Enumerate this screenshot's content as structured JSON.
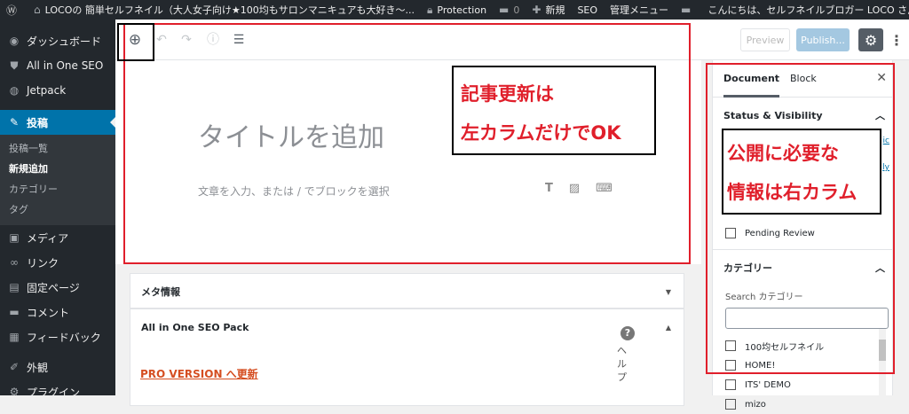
{
  "adminbar": {
    "site_name": "LOCOの 簡単セルフネイル（大人女子向け★100均もサロンマニキュアも大好き〜...",
    "protection": "Protection",
    "comments_count": "0",
    "new_label": "新規",
    "seo_label": "SEO",
    "admin_menu": "管理メニュー",
    "greeting": "こんにちは、セルフネイルブロガー LOCO さん"
  },
  "sidebar": {
    "items": [
      {
        "label": "ダッシュボード",
        "icon": "dashboard-icon"
      },
      {
        "label": "All in One SEO",
        "icon": "shield-icon"
      },
      {
        "label": "Jetpack",
        "icon": "jetpack-icon"
      },
      {
        "label": "投稿",
        "icon": "pin-icon"
      },
      {
        "label": "メディア",
        "icon": "media-icon"
      },
      {
        "label": "リンク",
        "icon": "link-icon"
      },
      {
        "label": "固定ページ",
        "icon": "page-icon"
      },
      {
        "label": "コメント",
        "icon": "comment-icon"
      },
      {
        "label": "フィードバック",
        "icon": "feedback-icon"
      },
      {
        "label": "外観",
        "icon": "brush-icon"
      },
      {
        "label": "プラグイン",
        "icon": "plugin-icon"
      }
    ],
    "submenu": [
      "投稿一覧",
      "新規追加",
      "カテゴリー",
      "タグ"
    ]
  },
  "header": {
    "preview": "Preview",
    "publish": "Publish..."
  },
  "editor": {
    "title_placeholder": "タイトルを追加",
    "block_placeholder": "文章を入力、または / でブロックを選択"
  },
  "metaboxes": {
    "meta_title": "メタ情報",
    "seo_title": "All in One SEO Pack",
    "pro_link": "PRO VERSION へ更新",
    "help": "ヘルプ"
  },
  "panel": {
    "tab_document": "Document",
    "tab_block": "Block",
    "status_title": "Status & Visibility",
    "peek_1": "ic",
    "peek_2": "ly",
    "pending_review": "Pending Review",
    "categories_title": "カテゴリー",
    "search_label": "Search カテゴリー",
    "categories": [
      "100均セルフネイル",
      "HOME!",
      "ITS' DEMO",
      "mizo"
    ]
  },
  "annotations": {
    "left_line1": "記事更新は",
    "left_line2": "左カラムだけでOK",
    "right_line1": "公開に必要な",
    "right_line2": "情報は右カラム"
  },
  "colors": {
    "annotation_red": "#e01f2b",
    "wp_blue": "#0073aa",
    "admin_dark": "#23282d"
  }
}
